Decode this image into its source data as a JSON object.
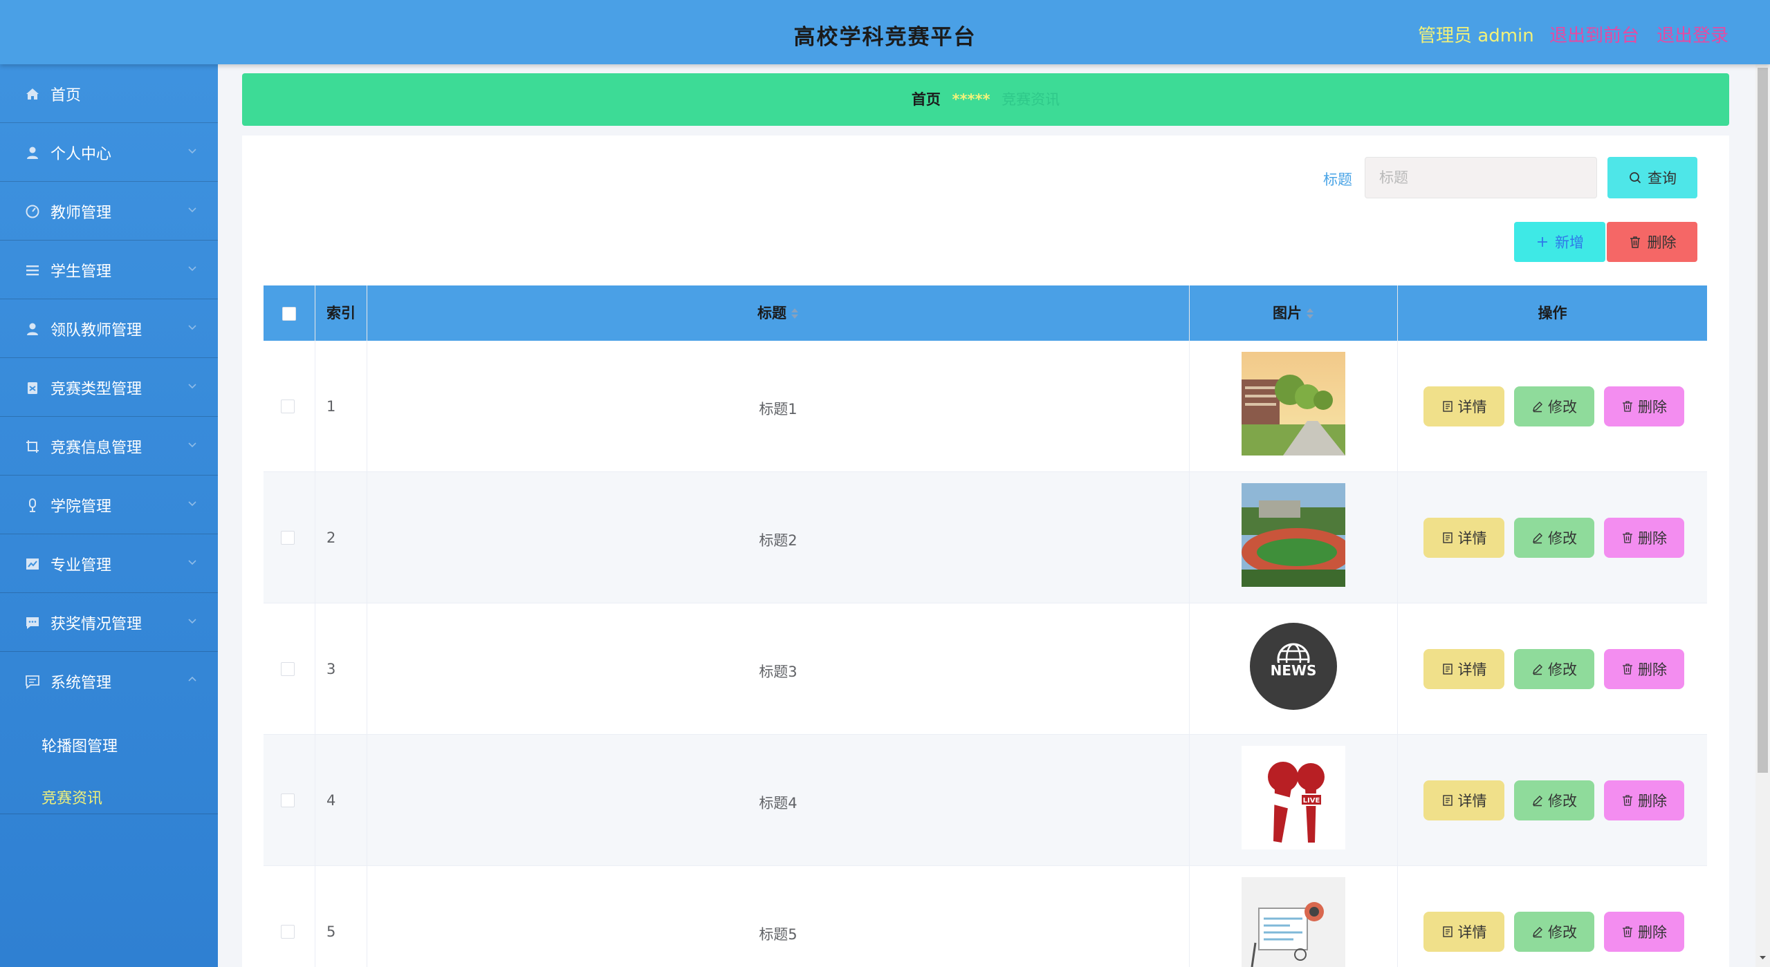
{
  "header": {
    "title": "高校学科竞赛平台",
    "admin": "管理员 admin",
    "to_front": "退出到前台",
    "logout": "退出登录"
  },
  "sidebar": {
    "items": [
      {
        "label": "首页",
        "icon": "home-icon"
      },
      {
        "label": "个人中心",
        "icon": "user-icon"
      },
      {
        "label": "教师管理",
        "icon": "dashboard-icon"
      },
      {
        "label": "学生管理",
        "icon": "list-icon"
      },
      {
        "label": "领队教师管理",
        "icon": "user-icon"
      },
      {
        "label": "竞赛类型管理",
        "icon": "clipboard-icon"
      },
      {
        "label": "竞赛信息管理",
        "icon": "crop-icon"
      },
      {
        "label": "学院管理",
        "icon": "mic-icon"
      },
      {
        "label": "专业管理",
        "icon": "chart-icon"
      },
      {
        "label": "获奖情况管理",
        "icon": "chat-icon"
      },
      {
        "label": "系统管理",
        "icon": "message-icon"
      }
    ],
    "sub_items": [
      "轮播图管理",
      "竞赛资讯"
    ]
  },
  "breadcrumb": {
    "home": "首页",
    "sep": "*****",
    "current": "竞赛资讯"
  },
  "search": {
    "label": "标题",
    "placeholder": "标题",
    "query": "查询",
    "add": "新增",
    "delete": "删除"
  },
  "table": {
    "headers": {
      "index": "索引",
      "title": "标题",
      "image": "图片",
      "actions": "操作"
    },
    "rows": [
      {
        "index": "1",
        "title": "标题1",
        "image": "campus-photo"
      },
      {
        "index": "2",
        "title": "标题2",
        "image": "track-field-photo"
      },
      {
        "index": "3",
        "title": "标题3",
        "image": "news-globe-badge"
      },
      {
        "index": "4",
        "title": "标题4",
        "image": "news-live-microphones"
      },
      {
        "index": "5",
        "title": "标题5",
        "image": "news-paper-illustration"
      }
    ],
    "actions": {
      "detail": "详情",
      "edit": "修改",
      "delete": "删除"
    }
  },
  "colors": {
    "header_bg": "#4aa0e6",
    "sidebar_bg": "#3e92df",
    "breadcrumb_bg": "#3ddb96",
    "admin_text": "#f1f17a",
    "logout_text": "#e54aa3",
    "active_sub": "#f1f17a"
  }
}
